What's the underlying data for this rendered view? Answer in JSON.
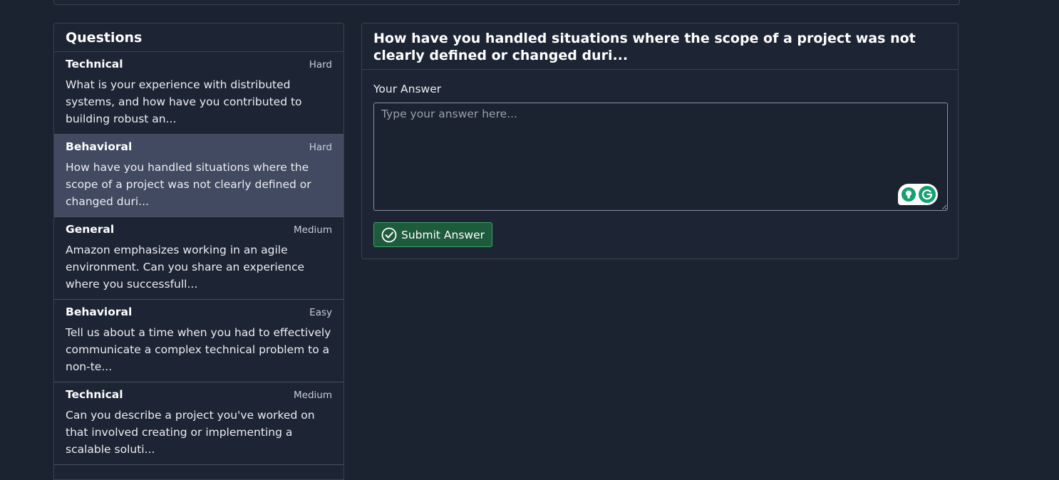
{
  "questions_panel": {
    "title": "Questions",
    "items": [
      {
        "category": "Technical",
        "difficulty": "Hard",
        "text": "What is your experience with distributed systems, and how have you contributed to building robust an...",
        "active": false
      },
      {
        "category": "Behavioral",
        "difficulty": "Hard",
        "text": "How have you handled situations where the scope of a project was not clearly defined or changed duri...",
        "active": true
      },
      {
        "category": "General",
        "difficulty": "Medium",
        "text": "Amazon emphasizes working in an agile environment. Can you share an experience where you successfull...",
        "active": false
      },
      {
        "category": "Behavioral",
        "difficulty": "Easy",
        "text": "Tell us about a time when you had to effectively communicate a complex technical problem to a non-te...",
        "active": false
      },
      {
        "category": "Technical",
        "difficulty": "Medium",
        "text": "Can you describe a project you've worked on that involved creating or implementing a scalable soluti...",
        "active": false
      }
    ]
  },
  "answer_panel": {
    "question_title": "How have you handled situations where the scope of a project was not clearly defined or changed duri...",
    "label": "Your Answer",
    "placeholder": "Type your answer here...",
    "submit_label": "Submit Answer"
  },
  "colors": {
    "background": "#1b2230",
    "panel": "#1d2433",
    "active_item": "#414a60",
    "submit_bg": "#1e5a3c",
    "submit_border": "#3f9f6a",
    "grammarly_green": "#15a070"
  },
  "icons": {
    "submit": "check-circle-icon",
    "grammarly_suggestion": "lightbulb-icon",
    "grammarly_logo": "grammarly-g-icon"
  }
}
